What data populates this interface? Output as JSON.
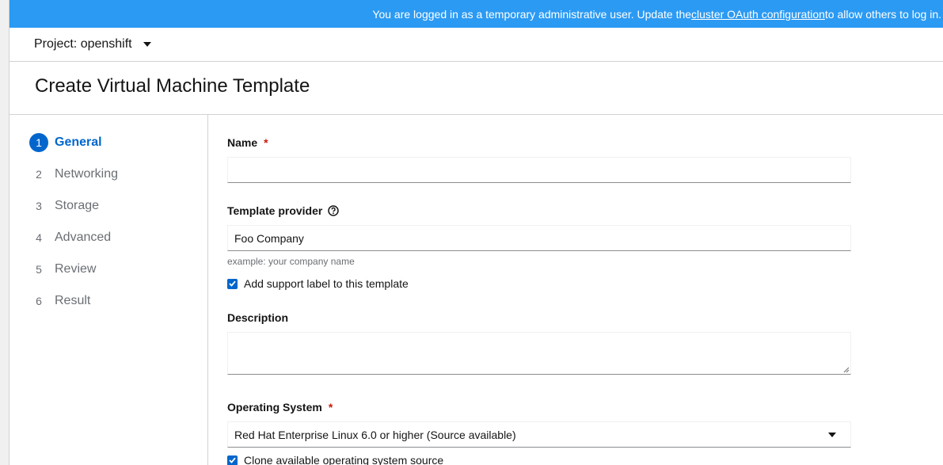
{
  "banner": {
    "text_before": "You are logged in as a temporary administrative user. Update the ",
    "link": "cluster OAuth configuration",
    "text_after": " to allow others to log in."
  },
  "project": {
    "label": "Project: openshift"
  },
  "page": {
    "title": "Create Virtual Machine Template"
  },
  "wizard": {
    "steps": [
      {
        "num": "1",
        "label": "General"
      },
      {
        "num": "2",
        "label": "Networking"
      },
      {
        "num": "3",
        "label": "Storage"
      },
      {
        "num": "4",
        "label": "Advanced"
      },
      {
        "num": "5",
        "label": "Review"
      },
      {
        "num": "6",
        "label": "Result"
      }
    ],
    "active_step": "General"
  },
  "form": {
    "name": {
      "label": "Name",
      "required": "*",
      "value": ""
    },
    "provider": {
      "label": "Template provider",
      "value": "Foo Company",
      "helper": "example: your company name"
    },
    "support_label": {
      "label": "Add support label to this template",
      "checked": true
    },
    "description": {
      "label": "Description",
      "value": ""
    },
    "os": {
      "label": "Operating System",
      "required": "*",
      "value": "Red Hat Enterprise Linux 6.0 or higher (Source available)"
    },
    "clone_source": {
      "label": "Clone available operating system source",
      "checked": true
    }
  },
  "colors": {
    "banner": "#2b9af3",
    "accent": "#0066cc",
    "required": "#c9190b"
  }
}
